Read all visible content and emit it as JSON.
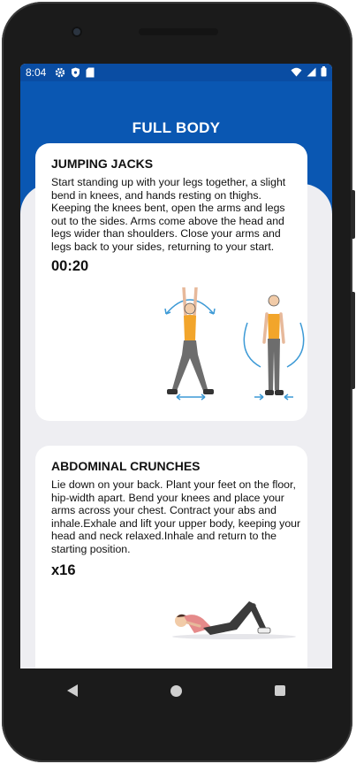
{
  "status": {
    "time": "8:04",
    "icons": [
      "gear-icon",
      "shield-icon",
      "sd-card-icon"
    ],
    "right_icons": [
      "wifi-icon",
      "signal-icon",
      "battery-icon"
    ]
  },
  "header": {
    "title": "FULL BODY"
  },
  "exercises": [
    {
      "title": "JUMPING JACKS",
      "description": "Start standing up with your legs together, a slight bend in knees, and hands resting on thighs. Keeping the knees bent, open the arms and legs out to the sides. Arms come above the head and legs wider than shoulders. Close your arms and legs back to your sides, returning to your start.",
      "stat": "00:20",
      "illustration": "jumping-jacks-illustration"
    },
    {
      "title": "ABDOMINAL CRUNCHES",
      "description": "Lie down on your back. Plant your feet on the floor, hip-width apart. Bend your knees and place your arms across your chest. Contract your abs and inhale.Exhale and lift your upper body, keeping your head and neck relaxed.Inhale and return to the starting position.",
      "stat": "x16",
      "illustration": "crunches-illustration"
    }
  ],
  "navbar": {
    "items": [
      "back-icon",
      "home-icon",
      "recents-icon"
    ]
  },
  "colors": {
    "primary": "#0a57b2",
    "status_bar": "#0a4da3",
    "background": "#eeeef2",
    "accent": "#f2a52b"
  }
}
